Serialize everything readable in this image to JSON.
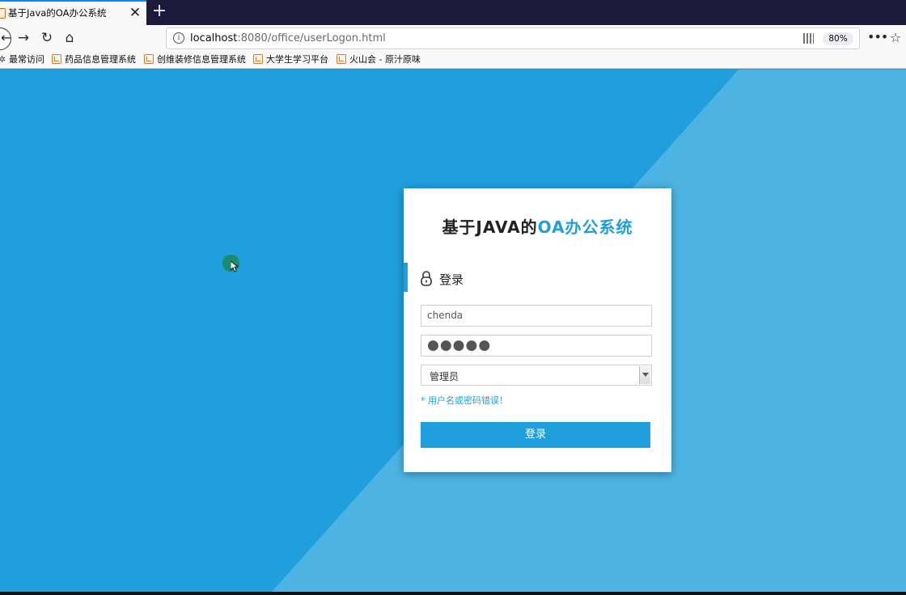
{
  "browser": {
    "tab": {
      "title": "基于Java的OA办公系统",
      "close": "✕"
    },
    "new_tab": "+",
    "nav": {
      "back": "←",
      "forward": "→",
      "reload": "↻",
      "home": "⌂"
    },
    "url": {
      "host": "localhost",
      "rest": ":8080/office/userLogon.html"
    },
    "zoom": "80%",
    "more": "•••",
    "star": "☆",
    "bookmarks": [
      "最常访问",
      "药品信息管理系统",
      "创维装修信息管理系统",
      "大学生学习平台",
      "火山会 - 原汁原味"
    ]
  },
  "colors": {
    "accent": "#1f9fdc",
    "page_bg": "#209fdd",
    "page_bg_light": "#4db3e2"
  },
  "login": {
    "title_part1": "基于JAVA的",
    "title_part2": "OA办公系统",
    "section_title": "登录",
    "username_value": "chenda",
    "password_mask": "●●●●●",
    "role_value": "管理员",
    "error": "* 用户名或密码错误！",
    "submit": "登录"
  }
}
